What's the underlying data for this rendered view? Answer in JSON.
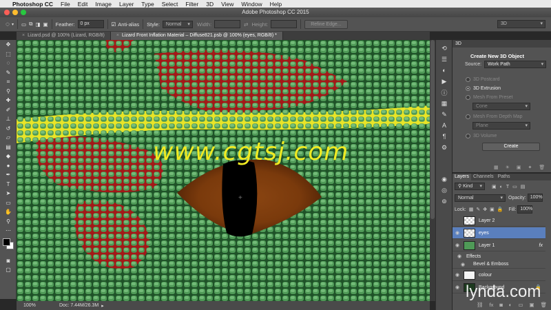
{
  "menubar": {
    "app_name": "Photoshop CC",
    "items": [
      "File",
      "Edit",
      "Image",
      "Layer",
      "Type",
      "Select",
      "Filter",
      "3D",
      "View",
      "Window",
      "Help"
    ]
  },
  "window": {
    "title": "Adobe Photoshop CC 2015"
  },
  "options": {
    "feather_label": "Feather:",
    "feather_value": "0 px",
    "antialias_label": "Anti-alias",
    "style_label": "Style:",
    "style_value": "Normal",
    "width_label": "Width:",
    "height_label": "Height:",
    "refine_edge": "Refine Edge...",
    "workspace": "3D"
  },
  "tabs": [
    {
      "label": "Lizard.psd @ 100% (Lizard, RGB/8)",
      "active": false
    },
    {
      "label": "Lizard Front Inflation Material – Diffuse821.psb @ 100% (eyes, RGB/8) *",
      "active": true
    }
  ],
  "watermark": "www.cgtsj.com",
  "status": {
    "zoom": "100%",
    "doc": "Doc: 7.44M/26.3M"
  },
  "panel3d": {
    "tab": "3D",
    "heading": "Create New 3D Object",
    "source_label": "Source:",
    "source_value": "Work Path",
    "options": [
      {
        "label": "3D Postcard",
        "selected": false
      },
      {
        "label": "3D Extrusion",
        "selected": true
      },
      {
        "label": "Mesh From Preset",
        "selected": false
      },
      {
        "label": "Mesh From Depth Map",
        "selected": false
      },
      {
        "label": "3D Volume",
        "selected": false
      }
    ],
    "preset_value": "Cone",
    "depthmap_value": "Plane",
    "create_button": "Create"
  },
  "layers_panel": {
    "tabs": [
      "Layers",
      "Channels",
      "Paths"
    ],
    "kind": "Kind",
    "blend_mode": "Normal",
    "opacity_label": "Opacity:",
    "opacity_value": "100%",
    "lock_label": "Lock:",
    "fill_label": "Fill:",
    "fill_value": "100%",
    "layers": [
      {
        "name": "Layer 2"
      },
      {
        "name": "eyes"
      },
      {
        "name": "Layer 1",
        "fx": "fx"
      },
      {
        "name": "Effects"
      },
      {
        "name": "Bevel & Emboss"
      },
      {
        "name": "colour"
      },
      {
        "name": "Background"
      }
    ]
  },
  "brand": "lynda.com",
  "colors": {
    "accent_select": "#5a7fbd",
    "menubar": "#e9e9e9",
    "canvas_green": "#2f6a34",
    "watermark": "#f0ea22"
  }
}
